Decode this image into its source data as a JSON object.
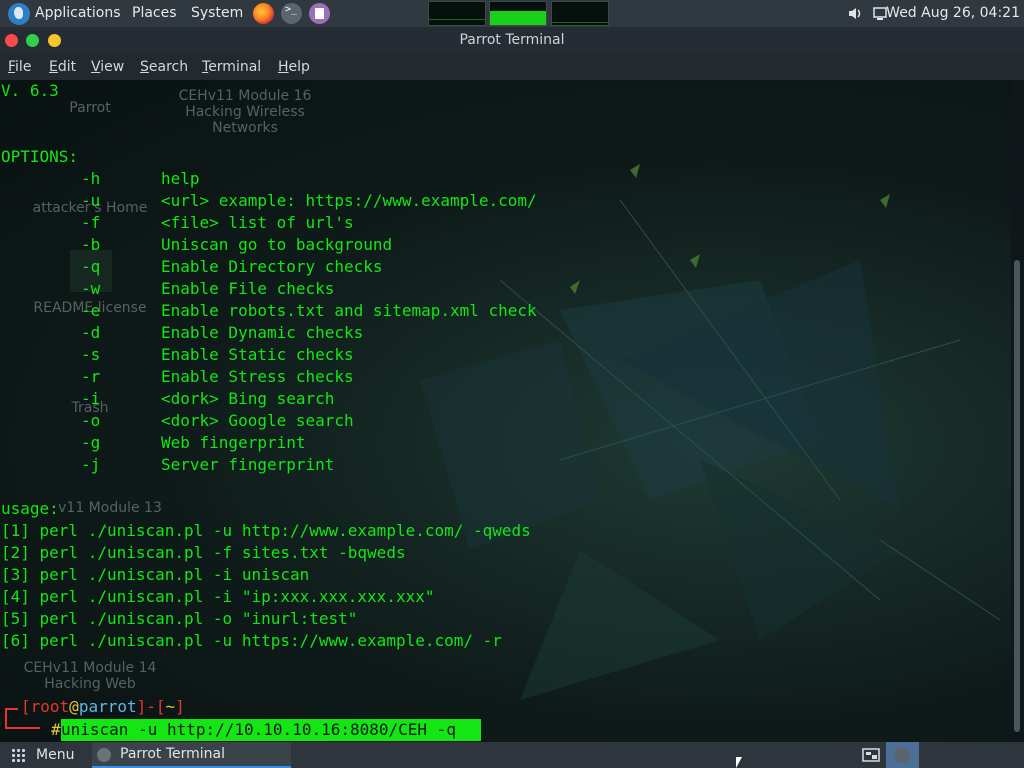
{
  "top_panel": {
    "applications": "Applications",
    "places": "Places",
    "system": "System",
    "clock": "Wed Aug 26, 04:21",
    "launchers": [
      "firefox-icon",
      "terminal-icon",
      "text-editor-icon"
    ]
  },
  "window": {
    "title": "Parrot Terminal"
  },
  "menubar": {
    "items": [
      "File",
      "Edit",
      "View",
      "Search",
      "Terminal",
      "Help"
    ]
  },
  "desktop_labels": [
    "Parrot",
    "CEHv11 Module 16\nHacking Wireless\nNetworks",
    "attacker's Home",
    "README.license",
    "Trash",
    "v11 Module 13\n...",
    "CEHv11 Module 14\nHacking Web"
  ],
  "terminal": {
    "version": "V. 6.3",
    "options_header": "OPTIONS:",
    "options": [
      {
        "flag": "-h",
        "desc": "help"
      },
      {
        "flag": "-u",
        "desc": "<url> example: https://www.example.com/"
      },
      {
        "flag": "-f",
        "desc": "<file> list of url's"
      },
      {
        "flag": "-b",
        "desc": "Uniscan go to background"
      },
      {
        "flag": "-q",
        "desc": "Enable Directory checks"
      },
      {
        "flag": "-w",
        "desc": "Enable File checks"
      },
      {
        "flag": "-e",
        "desc": "Enable robots.txt and sitemap.xml check"
      },
      {
        "flag": "-d",
        "desc": "Enable Dynamic checks"
      },
      {
        "flag": "-s",
        "desc": "Enable Static checks"
      },
      {
        "flag": "-r",
        "desc": "Enable Stress checks"
      },
      {
        "flag": "-i",
        "desc": "<dork> Bing search"
      },
      {
        "flag": "-o",
        "desc": "<dork> Google search"
      },
      {
        "flag": "-g",
        "desc": "Web fingerprint"
      },
      {
        "flag": "-j",
        "desc": "Server fingerprint"
      }
    ],
    "usage_header": "usage:",
    "usage": [
      "[1] perl ./uniscan.pl -u http://www.example.com/ -qweds",
      "[2] perl ./uniscan.pl -f sites.txt -bqweds",
      "[3] perl ./uniscan.pl -i uniscan",
      "[4] perl ./uniscan.pl -i \"ip:xxx.xxx.xxx.xxx\"",
      "[5] perl ./uniscan.pl -o \"inurl:test\"",
      "[6] perl ./uniscan.pl -u https://www.example.com/ -r"
    ],
    "prompt": {
      "open": "[",
      "user": "root",
      "at": "@",
      "host": "parrot",
      "sep": "]-[",
      "path": "~",
      "close": "]",
      "hash": "#",
      "command": "uniscan -u http://10.10.10.16:8080/CEH -q "
    }
  },
  "bottom_panel": {
    "menu_label": "Menu",
    "task_label": "Parrot Terminal"
  },
  "colors": {
    "terminal_text": "#14e614",
    "prompt_red": "#e8342e",
    "prompt_host": "#5fb8e8",
    "prompt_yellow": "#e8c534",
    "close_button": "#fc4a4a",
    "maximize_button": "#2fd14a",
    "minimize_button": "#f7c52a",
    "task_accent": "#3a8ee6"
  }
}
